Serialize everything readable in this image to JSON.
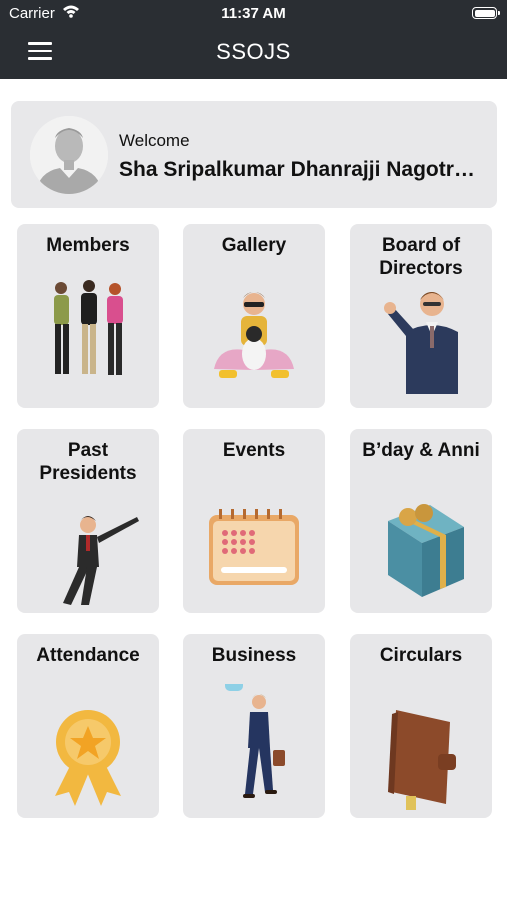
{
  "status_bar": {
    "carrier": "Carrier",
    "time": "11:37 AM"
  },
  "header": {
    "title": "SSOJS",
    "menu_icon": "hamburger-menu-icon"
  },
  "welcome": {
    "greeting": "Welcome",
    "name": "Sha Sripalkumar Dhanrajji Nagotr…"
  },
  "tiles": [
    {
      "label": "Members",
      "icon": "members-group-icon"
    },
    {
      "label": "Gallery",
      "icon": "gallery-icon"
    },
    {
      "label": "Board of Directors",
      "icon": "board-of-directors-icon"
    },
    {
      "label": "Past Presidents",
      "icon": "past-presidents-icon"
    },
    {
      "label": "Events",
      "icon": "calendar-icon"
    },
    {
      "label": "B’day & Anni",
      "icon": "gift-icon"
    },
    {
      "label": "Attendance",
      "icon": "badge-icon"
    },
    {
      "label": "Business",
      "icon": "business-icon"
    },
    {
      "label": "Circulars",
      "icon": "notebook-icon"
    }
  ]
}
